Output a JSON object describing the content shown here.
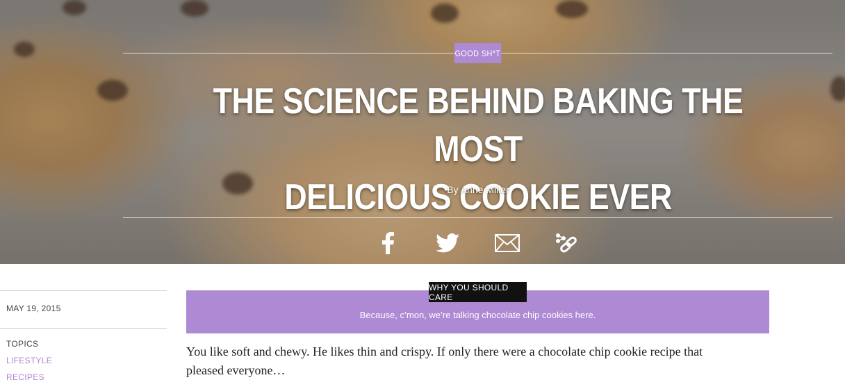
{
  "hero": {
    "category": "GOOD SH*T",
    "headline_line1": "THE SCIENCE BEHIND BAKING THE MOST",
    "headline_line2": "DELICIOUS COOKIE EVER",
    "byline": "By Anne Miller"
  },
  "share": {
    "icons": [
      "facebook-icon",
      "twitter-icon",
      "email-icon",
      "link-icon"
    ]
  },
  "sidebar": {
    "date": "MAY 19, 2015",
    "topics_label": "TOPICS",
    "topics": [
      "LIFESTYLE",
      "RECIPES"
    ]
  },
  "care": {
    "label": "WHY YOU SHOULD CARE",
    "text": "Because, c’mon, we’re talking chocolate chip cookies here."
  },
  "article": {
    "intro": "You like soft and chewy. He likes thin and crispy. If only there were a chocolate chip cookie recipe that pleased everyone…"
  },
  "colors": {
    "accent": "#ae89d4",
    "label_bg": "#111111",
    "text": "#222222"
  }
}
